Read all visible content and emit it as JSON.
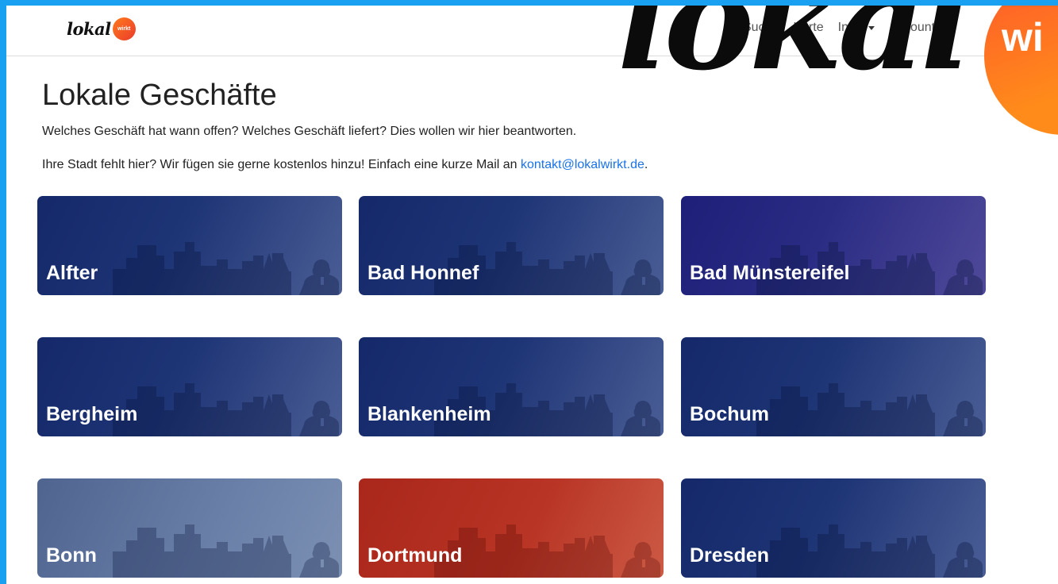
{
  "brand": {
    "logo_word": "lokal",
    "logo_badge": "wirkt"
  },
  "nav": {
    "items": [
      {
        "label": "Suche",
        "dropdown": false
      },
      {
        "label": "Karte",
        "dropdown": false
      },
      {
        "label": "Infos",
        "dropdown": true
      },
      {
        "label": "Account",
        "dropdown": true
      }
    ]
  },
  "overlay_logo": {
    "word": "lokal",
    "badge": "wi"
  },
  "page": {
    "title": "Lokale Geschäfte",
    "subtitle": "Welches Geschäft hat wann offen? Welches Geschäft liefert? Dies wollen wir hier beantworten.",
    "missing_text": "Ihre Stadt fehlt hier? Wir fügen sie gerne kostenlos hinzu! Einfach eine kurze Mail an ",
    "missing_email": "kontakt@lokalwirkt.de",
    "missing_end": "."
  },
  "cities": [
    {
      "name": "Alfter",
      "theme": "navy"
    },
    {
      "name": "Bad Honnef",
      "theme": "navy"
    },
    {
      "name": "Bad Münstereifel",
      "theme": "indigo"
    },
    {
      "name": "Bergheim",
      "theme": "navy"
    },
    {
      "name": "Blankenheim",
      "theme": "navy"
    },
    {
      "name": "Bochum",
      "theme": "navy"
    },
    {
      "name": "Bonn",
      "theme": "slate"
    },
    {
      "name": "Dortmund",
      "theme": "red"
    },
    {
      "name": "Dresden",
      "theme": "navy"
    }
  ],
  "colors": {
    "accent_link": "#1a73e8",
    "frame_border": "#1aa0f0",
    "card_navy": "#15296a",
    "card_indigo": "#1d1f78",
    "card_slate": "#5a6f98",
    "card_red": "#b0291d"
  },
  "icons": {
    "dropdown": "caret-down-icon",
    "card_art": "city-skyline-icon"
  }
}
